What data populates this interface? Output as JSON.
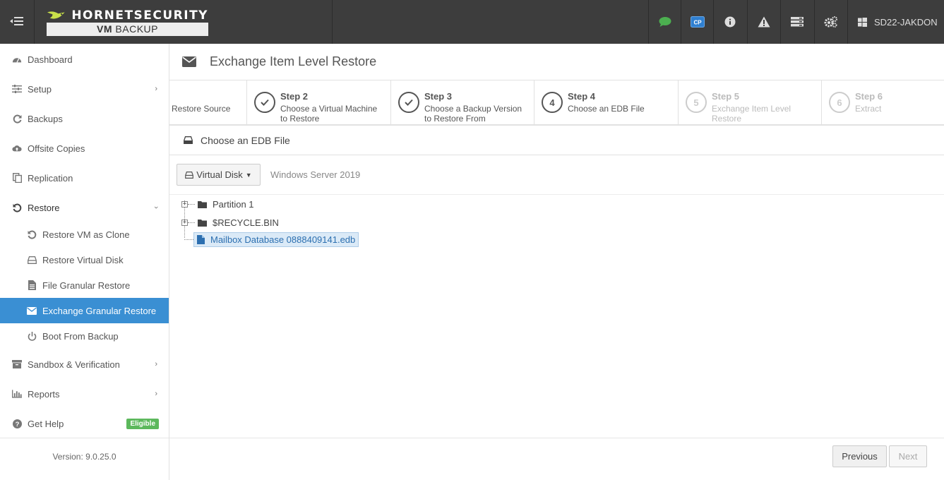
{
  "header": {
    "brand_top": "HORNETSECURITY",
    "brand_bottom_bold": "VM",
    "brand_bottom_rest": " BACKUP",
    "icons": [
      "sidebar-toggle-icon",
      "chat-icon",
      "cp-icon",
      "info-icon",
      "warning-icon",
      "server-list-icon",
      "settings-icon",
      "windows-icon"
    ],
    "cp_label": "CP",
    "host": "SD22-JAKDON",
    "chat_color": "#4caf50",
    "cp_color": "#2f7fd0"
  },
  "sidebar": {
    "items": [
      {
        "label": "Dashboard",
        "icon": "dashboard-icon"
      },
      {
        "label": "Setup",
        "icon": "sliders-icon"
      },
      {
        "label": "Backups",
        "icon": "refresh-icon"
      },
      {
        "label": "Offsite Copies",
        "icon": "cloud-upload-icon"
      },
      {
        "label": "Replication",
        "icon": "copy-icon"
      },
      {
        "label": "Restore",
        "icon": "undo-icon"
      },
      {
        "label": "Restore VM as Clone",
        "icon": "undo-icon"
      },
      {
        "label": "Restore Virtual Disk",
        "icon": "hdd-icon"
      },
      {
        "label": "File Granular Restore",
        "icon": "file-icon"
      },
      {
        "label": "Exchange Granular Restore",
        "icon": "envelope-icon"
      },
      {
        "label": "Boot From Backup",
        "icon": "power-icon"
      },
      {
        "label": "Sandbox & Verification",
        "icon": "archive-icon"
      },
      {
        "label": "Reports",
        "icon": "bar-chart-icon"
      },
      {
        "label": "Get Help",
        "icon": "question-icon"
      }
    ],
    "help_badge": "Eligible",
    "version": "Version: 9.0.25.0",
    "active_color": "#3a8fd3"
  },
  "page": {
    "title": "Exchange Item Level Restore"
  },
  "steps": [
    {
      "number": "",
      "title": "",
      "desc": "Restore Source",
      "state": "done"
    },
    {
      "number": "",
      "title": "Step 2",
      "desc": "Choose a Virtual Machine to Restore",
      "state": "done"
    },
    {
      "number": "",
      "title": "Step 3",
      "desc": "Choose a Backup Version to Restore From",
      "state": "done"
    },
    {
      "number": "4",
      "title": "Step 4",
      "desc": "Choose an EDB File",
      "state": "current"
    },
    {
      "number": "5",
      "title": "Step 5",
      "desc": "Exchange Item Level Restore",
      "state": "pending"
    },
    {
      "number": "6",
      "title": "Step 6",
      "desc": "Extract",
      "state": "pending"
    }
  ],
  "section": {
    "title": "Choose an EDB File"
  },
  "toolbar": {
    "disk_label": "Virtual Disk",
    "os_label": "Windows Server 2019"
  },
  "tree": [
    {
      "label": "Partition 1",
      "type": "folder",
      "expandable": true
    },
    {
      "label": "$RECYCLE.BIN",
      "type": "folder",
      "expandable": true
    },
    {
      "label": "Mailbox Database 0888409141.edb",
      "type": "file",
      "expandable": false,
      "selected": true
    }
  ],
  "footer": {
    "prev_label": "Previous",
    "next_label": "Next"
  }
}
